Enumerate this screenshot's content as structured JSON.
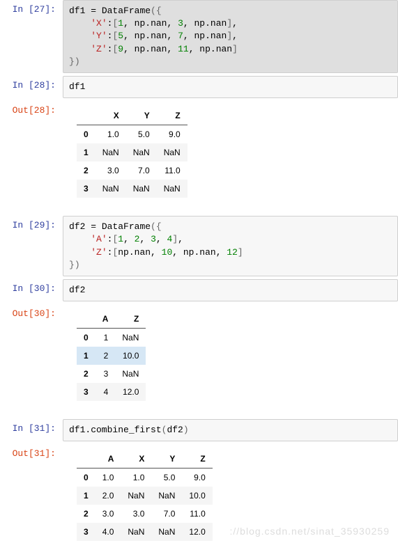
{
  "cells": {
    "c27": {
      "prompt": "In  [27]:",
      "code_html": "df1 <span class='c-func'>=</span> DataFrame<span class='c-paren'>(</span><span class='c-paren'>{</span>\n    <span class='c-string'>'X'</span>:<span class='c-paren'>[</span><span class='c-num'>1</span>, np.nan, <span class='c-num'>3</span>, np.nan<span class='c-paren'>]</span>,\n    <span class='c-string'>'Y'</span>:<span class='c-paren'>[</span><span class='c-num'>5</span>, np.nan, <span class='c-num'>7</span>, np.nan<span class='c-paren'>]</span>,\n    <span class='c-string'>'Z'</span>:<span class='c-paren'>[</span><span class='c-num'>9</span>, np.nan, <span class='c-num'>11</span>, np.nan<span class='c-paren'>]</span>\n<span class='c-paren'>}</span><span class='c-paren'>)</span>"
    },
    "c28": {
      "prompt": "In  [28]:",
      "code_html": "df1"
    },
    "c28o": {
      "prompt": "Out[28]:",
      "headers": [
        "",
        "X",
        "Y",
        "Z"
      ],
      "rows": [
        {
          "idx": "0",
          "vals": [
            "1.0",
            "5.0",
            "9.0"
          ]
        },
        {
          "idx": "1",
          "vals": [
            "NaN",
            "NaN",
            "NaN"
          ]
        },
        {
          "idx": "2",
          "vals": [
            "3.0",
            "7.0",
            "11.0"
          ]
        },
        {
          "idx": "3",
          "vals": [
            "NaN",
            "NaN",
            "NaN"
          ]
        }
      ]
    },
    "c29": {
      "prompt": "In  [29]:",
      "code_html": "df2 <span class='c-func'>=</span> DataFrame<span class='c-paren'>(</span><span class='c-paren'>{</span>\n    <span class='c-string'>'A'</span>:<span class='c-paren'>[</span><span class='c-num'>1</span>, <span class='c-num'>2</span>, <span class='c-num'>3</span>, <span class='c-num'>4</span><span class='c-paren'>]</span>,\n    <span class='c-string'>'Z'</span>:<span class='c-paren'>[</span>np.nan, <span class='c-num'>10</span>, np.nan, <span class='c-num'>12</span><span class='c-paren'>]</span>\n<span class='c-paren'>}</span><span class='c-paren'>)</span>"
    },
    "c30": {
      "prompt": "In  [30]:",
      "code_html": "df2"
    },
    "c30o": {
      "prompt": "Out[30]:",
      "headers": [
        "",
        "A",
        "Z"
      ],
      "rows": [
        {
          "idx": "0",
          "vals": [
            "1",
            "NaN"
          ]
        },
        {
          "idx": "1",
          "vals": [
            "2",
            "10.0"
          ],
          "highlight": true
        },
        {
          "idx": "2",
          "vals": [
            "3",
            "NaN"
          ]
        },
        {
          "idx": "3",
          "vals": [
            "4",
            "12.0"
          ]
        }
      ]
    },
    "c31": {
      "prompt": "In  [31]:",
      "code_html": "df1.combine_first<span class='c-paren'>(</span>df2<span class='c-paren'>)</span>"
    },
    "c31o": {
      "prompt": "Out[31]:",
      "headers": [
        "",
        "A",
        "X",
        "Y",
        "Z"
      ],
      "rows": [
        {
          "idx": "0",
          "vals": [
            "1.0",
            "1.0",
            "5.0",
            "9.0"
          ]
        },
        {
          "idx": "1",
          "vals": [
            "2.0",
            "NaN",
            "NaN",
            "10.0"
          ]
        },
        {
          "idx": "2",
          "vals": [
            "3.0",
            "3.0",
            "7.0",
            "11.0"
          ]
        },
        {
          "idx": "3",
          "vals": [
            "4.0",
            "NaN",
            "NaN",
            "12.0"
          ]
        }
      ]
    }
  },
  "watermark": "://blog.csdn.net/sinat_35930259"
}
